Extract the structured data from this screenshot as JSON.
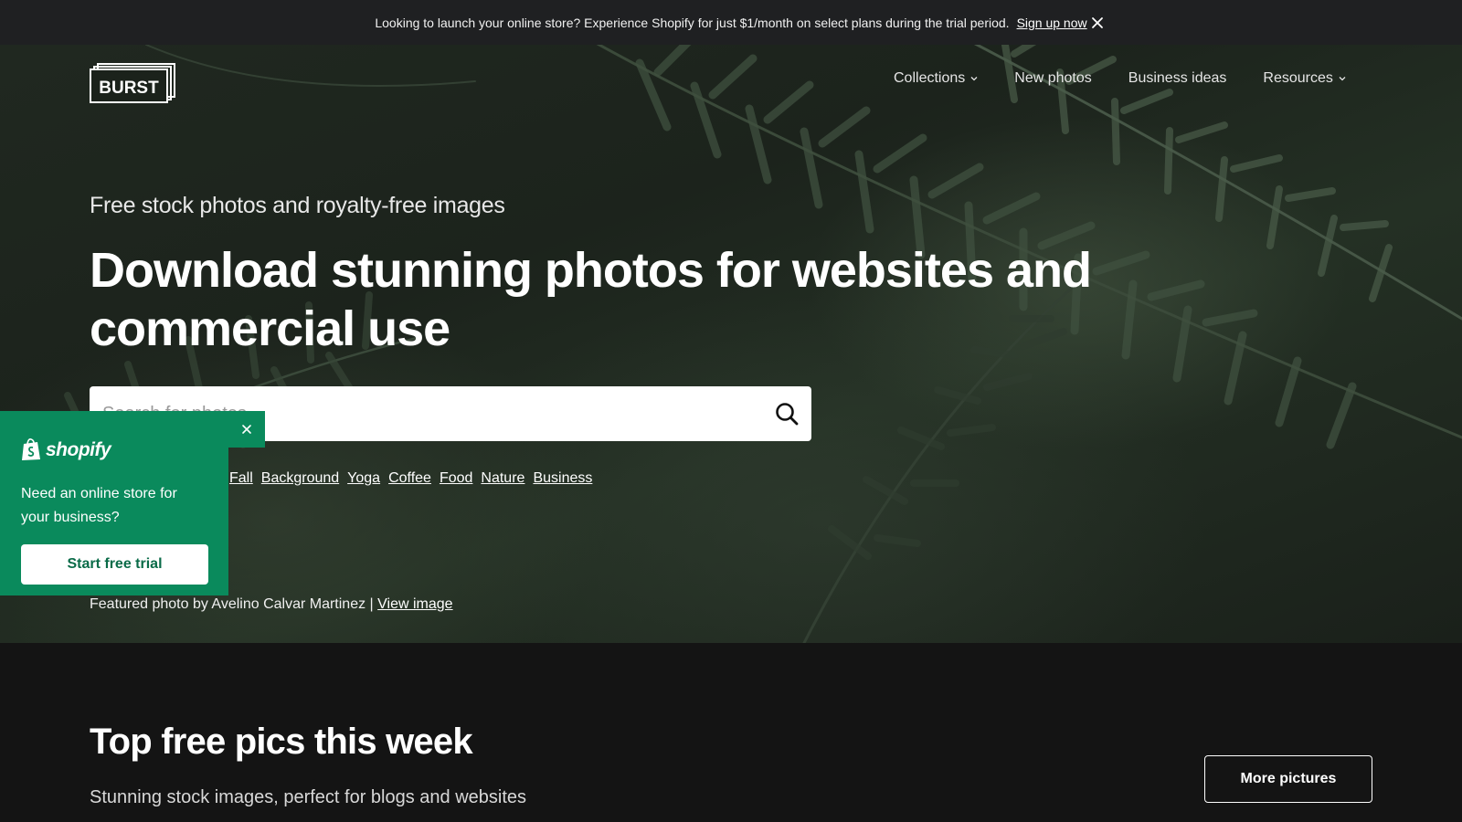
{
  "announcement": {
    "message": "Looking to launch your online store? Experience Shopify for just $1/month on select plans during the trial period.",
    "link_label": "Sign up now",
    "close_icon": "close-icon"
  },
  "header": {
    "logo_text": "BURST",
    "nav": [
      {
        "label": "Collections",
        "has_dropdown": true
      },
      {
        "label": "New photos",
        "has_dropdown": false
      },
      {
        "label": "Business ideas",
        "has_dropdown": false
      },
      {
        "label": "Resources",
        "has_dropdown": true
      }
    ]
  },
  "hero": {
    "kicker": "Free stock photos and royalty-free images",
    "headline": "Download stunning photos for websites and commercial use",
    "search": {
      "placeholder": "Search for photos",
      "button_icon": "search-icon"
    },
    "tags": [
      "Fall",
      "Background",
      "Yoga",
      "Coffee",
      "Food",
      "Nature",
      "Business"
    ],
    "credit": {
      "text": "Featured photo by Avelino Calvar Martinez |",
      "link_label": "View image"
    }
  },
  "shopify_popup": {
    "brand": "shopify",
    "text": "Need an online store for your business?",
    "cta_label": "Start free trial",
    "close_icon": "close-icon"
  },
  "section": {
    "title": "Top free pics this week",
    "subtitle": "Stunning stock images, perfect for blogs and websites",
    "more_label": "More pictures"
  },
  "colors": {
    "announcement_bg": "#1f2022",
    "page_bg": "#141414",
    "shopify_green": "#0a8a5c",
    "hero_foliage": "#2a3a2a"
  }
}
